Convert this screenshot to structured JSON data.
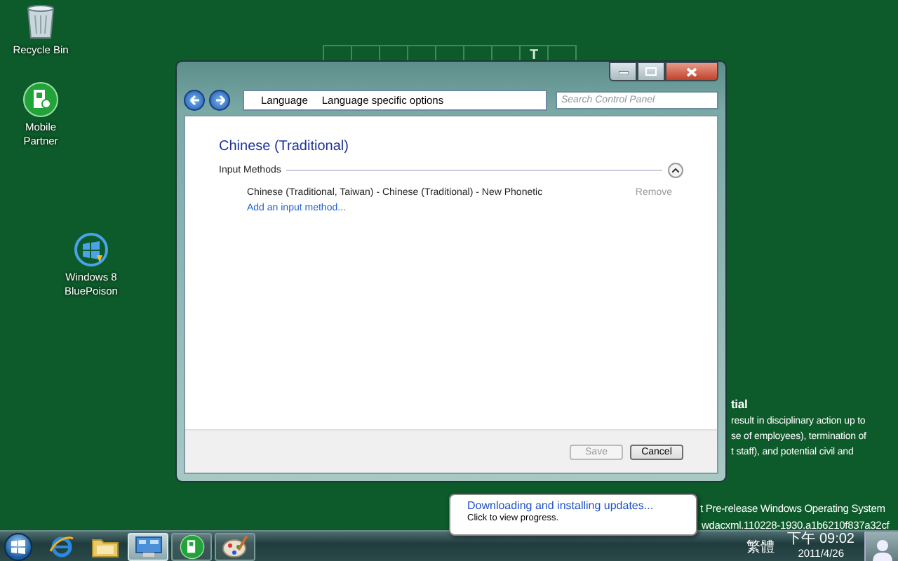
{
  "desktop_icons": [
    {
      "label": "Recycle Bin",
      "kind": "recycle-bin"
    },
    {
      "label": "Mobile Partner",
      "kind": "mobile-partner"
    },
    {
      "label": "Windows 8 BluePoison",
      "kind": "windows-logo"
    }
  ],
  "wallpaper": {
    "grid_letter": "T",
    "heading": "tial",
    "lines": [
      "result in disciplinary action up to",
      "se of employees), termination of",
      "t staff), and potential civil and"
    ],
    "build_lines": [
      "t Pre-release Windows Operating System",
      "wdacxml.110228-1930.a1b6210f837a32cf"
    ]
  },
  "window": {
    "breadcrumb": [
      "Language",
      "Language specific options"
    ],
    "search": {
      "placeholder": "Search Control Panel"
    },
    "heading": "Chinese (Traditional)",
    "section": {
      "title": "Input Methods",
      "expanded": true
    },
    "input_methods": [
      {
        "name": "Chinese (Traditional, Taiwan) - Chinese (Traditional) - New Phonetic",
        "action": "Remove"
      }
    ],
    "add_link": "Add an input method...",
    "buttons": [
      {
        "label": "Save",
        "disabled": true
      },
      {
        "label": "Cancel",
        "disabled": false
      }
    ]
  },
  "balloon": {
    "title": "Downloading and installing updates...",
    "subtitle": "Click to view progress."
  },
  "taskbar": {
    "apps": [
      {
        "kind": "browser",
        "selected": false,
        "running": false
      },
      {
        "kind": "folder",
        "selected": false,
        "running": false
      },
      {
        "kind": "control-panel",
        "selected": true,
        "running": true
      },
      {
        "kind": "mobile-partner",
        "selected": false,
        "running": true
      },
      {
        "kind": "paint",
        "selected": false,
        "running": true
      }
    ],
    "tray": {
      "language": "繁體",
      "time": "下午 09:02",
      "date": "2011/4/26"
    }
  }
}
